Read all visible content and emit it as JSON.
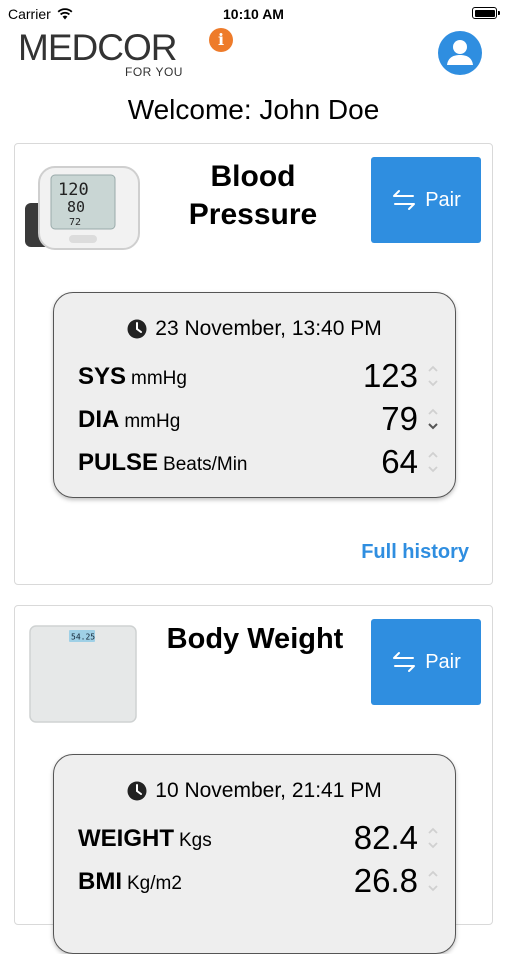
{
  "status": {
    "carrier": "Carrier",
    "time": "10:10 AM"
  },
  "header": {
    "logo_text": "MEDCOR",
    "logo_sub": "FOR YOU",
    "info_icon": "info-icon",
    "profile_icon": "user-icon"
  },
  "welcome": "Welcome: John Doe",
  "blood_pressure": {
    "title_line1": "Blood",
    "title_line2": "Pressure",
    "pair_label": "Pair",
    "date": "23 November, 13:40 PM",
    "rows": [
      {
        "name": "SYS",
        "unit": "mmHg",
        "value": "123"
      },
      {
        "name": "DIA",
        "unit": "mmHg",
        "value": "79"
      },
      {
        "name": "PULSE",
        "unit": "Beats/Min",
        "value": "64"
      }
    ],
    "full_history": "Full history",
    "device_screen": {
      "line1": "120",
      "line2": "80",
      "line3": "72"
    }
  },
  "body_weight": {
    "title": "Body Weight",
    "pair_label": "Pair",
    "date": "10 November, 21:41 PM",
    "rows": [
      {
        "name": "WEIGHT",
        "unit": "Kgs",
        "value": "82.4"
      },
      {
        "name": "BMI",
        "unit": "Kg/m2",
        "value": "26.8"
      }
    ],
    "scale_display": "54.25"
  },
  "colors": {
    "accent": "#2f8ee0",
    "logo_heart": "#ee7b2a",
    "reading_bg": "#eeeeee"
  }
}
